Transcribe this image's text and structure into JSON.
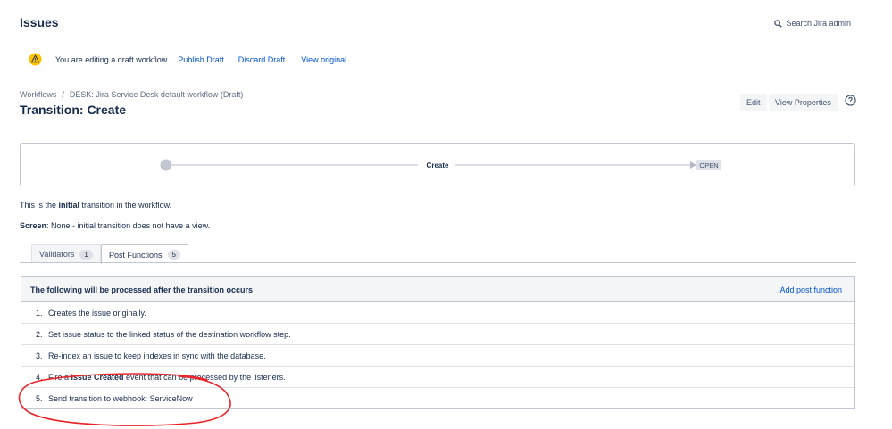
{
  "header": {
    "title": "Issues",
    "search_label": "Search Jira admin"
  },
  "draft_notice": {
    "message": "You are editing a draft workflow.",
    "publish": "Publish Draft",
    "discard": "Discard Draft",
    "view_original": "View original"
  },
  "breadcrumb": {
    "root": "Workflows",
    "separator": "/",
    "current": "DESK: Jira Service Desk default workflow (Draft)"
  },
  "transition": {
    "title": "Transition: Create",
    "edit_label": "Edit",
    "view_properties_label": "View Properties"
  },
  "diagram": {
    "transition_name": "Create",
    "target_status": "OPEN"
  },
  "info": {
    "line1_prefix": "This is the ",
    "line1_bold": "initial",
    "line1_suffix": " transition in the workflow.",
    "line2_bold": "Screen",
    "line2_rest": ": None - initial transition does not have a view."
  },
  "tabs": [
    {
      "label": "Validators",
      "count": "1"
    },
    {
      "label": "Post Functions",
      "count": "5"
    }
  ],
  "post_functions": {
    "heading": "The following will be processed after the transition occurs",
    "add_label": "Add post function",
    "items": [
      {
        "num": "1.",
        "text": "Creates the issue originally."
      },
      {
        "num": "2.",
        "text": "Set issue status to the linked status of the destination workflow step."
      },
      {
        "num": "3.",
        "text": "Re-index an issue to keep indexes in sync with the database."
      },
      {
        "num": "4.",
        "pre": "Fire a ",
        "bold": "Issue Created",
        "post": " event that can be processed by the listeners."
      },
      {
        "num": "5.",
        "text": "Send transition to webhook: ServiceNow"
      }
    ]
  },
  "colors": {
    "link": "#0052cc",
    "annotation": "#e8262a",
    "warning": "#ffc400"
  }
}
